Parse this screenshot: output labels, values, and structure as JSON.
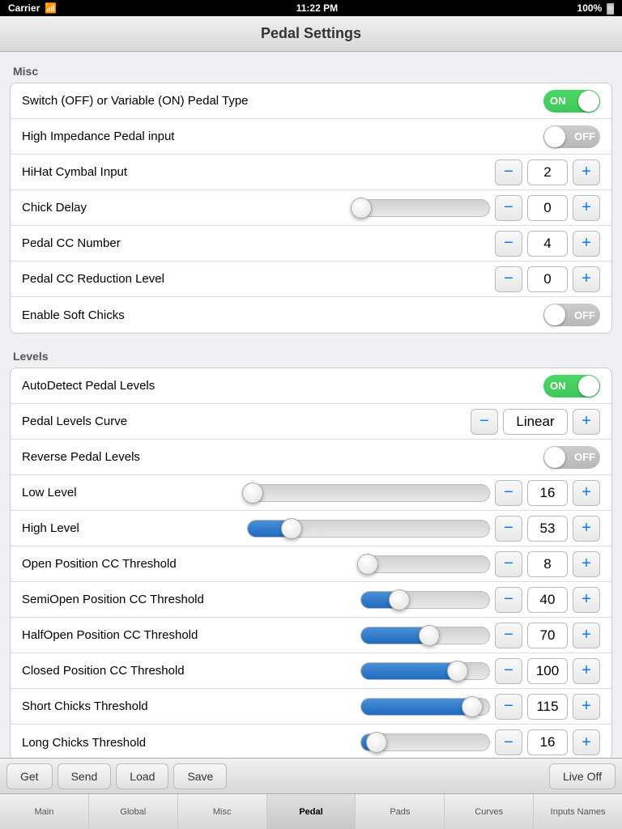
{
  "statusBar": {
    "carrier": "Carrier",
    "time": "11:22 PM",
    "battery": "100%"
  },
  "navBar": {
    "title": "Pedal Settings"
  },
  "misc": {
    "sectionLabel": "Misc",
    "rows": [
      {
        "label": "Switch (OFF) or Variable (ON) Pedal Type",
        "type": "toggle",
        "value": "ON",
        "on": true
      },
      {
        "label": "High Impedance Pedal input",
        "type": "toggle",
        "value": "OFF",
        "on": false
      },
      {
        "label": "HiHat Cymbal Input",
        "type": "stepper",
        "value": "2"
      },
      {
        "label": "Chick Delay",
        "type": "chick-slider",
        "sliderPercent": 0,
        "value": "0"
      },
      {
        "label": "Pedal CC Number",
        "type": "stepper",
        "value": "4"
      },
      {
        "label": "Pedal CC Reduction Level",
        "type": "stepper",
        "value": "0"
      },
      {
        "label": "Enable Soft Chicks",
        "type": "toggle",
        "value": "OFF",
        "on": false
      }
    ]
  },
  "levels": {
    "sectionLabel": "Levels",
    "rows": [
      {
        "label": "AutoDetect Pedal Levels",
        "type": "toggle",
        "value": "ON",
        "on": true
      },
      {
        "label": "Pedal Levels Curve",
        "type": "stepper-text",
        "value": "Linear"
      },
      {
        "label": "Reverse Pedal Levels",
        "type": "toggle",
        "value": "OFF",
        "on": false
      },
      {
        "label": "Low Level",
        "type": "slider-stepper",
        "sliderPercent": 2,
        "value": "16"
      },
      {
        "label": "High Level",
        "type": "slider-stepper",
        "sliderPercent": 18,
        "value": "53"
      },
      {
        "label": "Open Position CC Threshold",
        "type": "slider-stepper",
        "sliderPercent": 5,
        "value": "8"
      },
      {
        "label": "SemiOpen Position CC Threshold",
        "type": "slider-stepper",
        "sliderPercent": 30,
        "value": "40"
      },
      {
        "label": "HalfOpen Position CC Threshold",
        "type": "slider-stepper",
        "sliderPercent": 53,
        "value": "70"
      },
      {
        "label": "Closed Position CC Threshold",
        "type": "slider-stepper",
        "sliderPercent": 74,
        "value": "100"
      },
      {
        "label": "Short Chicks Threshold",
        "type": "slider-stepper",
        "sliderPercent": 87,
        "value": "115"
      }
    ]
  },
  "toolbar": {
    "get": "Get",
    "send": "Send",
    "load": "Load",
    "save": "Save",
    "live": "Live Off"
  },
  "tabs": [
    {
      "label": "Main",
      "active": false
    },
    {
      "label": "Global",
      "active": false
    },
    {
      "label": "Misc",
      "active": false
    },
    {
      "label": "Pedal",
      "active": true
    },
    {
      "label": "Pads",
      "active": false
    },
    {
      "label": "Curves",
      "active": false
    },
    {
      "label": "Inputs Names",
      "active": false
    }
  ],
  "icons": {
    "wifi": "WiFi",
    "battery": "🔋",
    "minus": "−",
    "plus": "+"
  }
}
